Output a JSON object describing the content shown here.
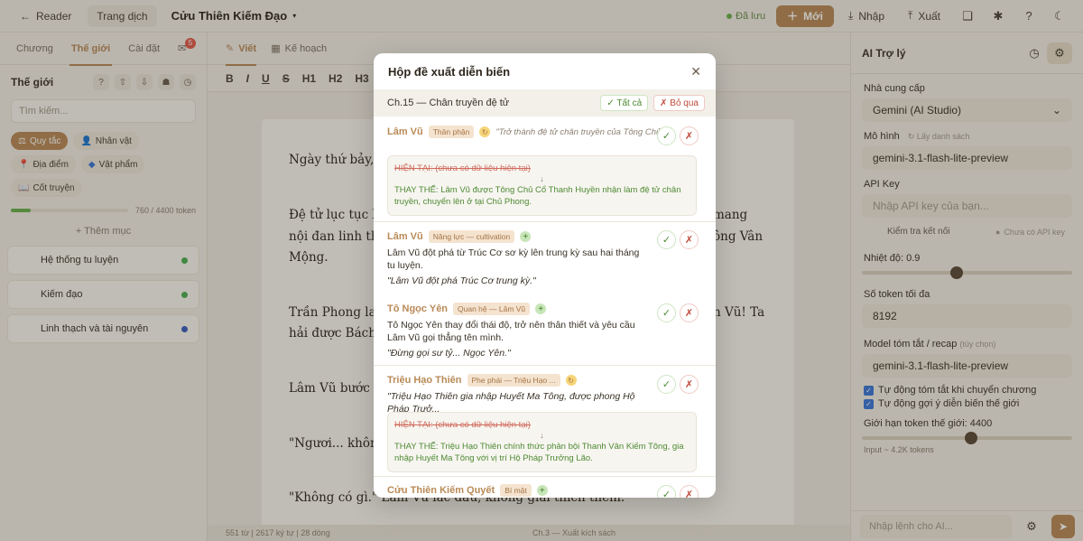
{
  "topbar": {
    "back_label": "Reader",
    "translate_label": "Trang dịch",
    "story_title": "Cửu Thiên Kiếm Đạo",
    "saved_label": "Đã lưu",
    "new_label": "Mới",
    "import_label": "Nhập",
    "export_label": "Xuất"
  },
  "left": {
    "tabs": [
      "Chương",
      "Thế giới",
      "Cài đặt"
    ],
    "notif_count": "5",
    "section_title": "Thế giới",
    "search_placeholder": "Tìm kiếm...",
    "chips": [
      "Quy tắc",
      "Nhân vật",
      "Địa điểm",
      "Vật phẩm",
      "Cốt truyện"
    ],
    "token_usage": "760 / 4400 token",
    "token_fraction": 0.17,
    "add_label": "+ Thêm mục",
    "cards": [
      {
        "label": "Hệ thống tu luyện",
        "color": "#4caf50"
      },
      {
        "label": "Kiếm đạo",
        "color": "#4caf50"
      },
      {
        "label": "Linh thạch và tài nguyên",
        "color": "#3b5fc0"
      }
    ]
  },
  "editor": {
    "tabs": [
      "Viết",
      "Kế hoạch"
    ],
    "format": [
      "B",
      "I",
      "U",
      "S",
      "H1",
      "H2",
      "H3"
    ],
    "paragraphs": [
      "Ngày thứ bảy, c",
      "Đệ tử lục tục bư",
      "nội đan linh th",
      "Mộng.",
      "Trần Phong lao",
      "hải được Bách",
      "Lâm Vũ bước r",
      "\"Ngươi... không",
      "\"Không có gì.\" Lâm Vũ lắc đầu, không giải thích thêm."
    ],
    "right_fragments": [
      "mang",
      "ông Vân",
      "n Vũ! Ta"
    ],
    "footer": "551 từ | 2617 ký tự | 28 dòng",
    "footer_chapter": "Ch.3 — Xuất kích sách"
  },
  "right": {
    "title": "AI Trợ lý",
    "provider_label": "Nhà cung cấp",
    "provider_value": "Gemini (AI Studio)",
    "model_label": "Mô hình",
    "model_refresh": "↻ Lấy danh sách",
    "model_value": "gemini-3.1-flash-lite-preview",
    "apikey_label": "API Key",
    "apikey_placeholder": "Nhập API key của bạn...",
    "check_label": "Kiểm tra kết nối",
    "nokey_label": "Chưa có API key",
    "temp_label": "Nhiệt độ: 0.9",
    "temp_fraction": 0.45,
    "maxtok_label": "Số token tối đa",
    "maxtok_value": "8192",
    "summary_label": "Model tóm tắt / recap",
    "summary_optional": "(tùy chọn)",
    "summary_value": "gemini-3.1-flash-lite-preview",
    "cb1": "Tự động tóm tắt khi chuyển chương",
    "cb2": "Tự động gợi ý diễn biến thế giới",
    "limit_label": "Giới hạn token thế giới: 4400",
    "limit_fraction": 0.52,
    "input_tokens": "Input ~ 4.2K tokens",
    "command_placeholder": "Nhập lệnh cho AI..."
  },
  "modal": {
    "title": "Hộp đề xuất diễn biến",
    "chapter": "Ch.15 — Chân truyền đệ tử",
    "accept_all": "✓ Tất cả",
    "skip": "✗ Bỏ qua",
    "items": [
      {
        "name": "Lâm Vũ",
        "tag": "Thân phận",
        "quote": "\"Trở thành đệ tử chân truyền của Tông Chủ\"",
        "old": "HIỆN TẠI: (chưa có dữ liệu hiện tại)",
        "new": "THAY THẾ: Lâm Vũ được Tông Chủ Cổ Thanh Huyền nhận làm đệ tử chân truyền, chuyển lên ở tại Chủ Phong."
      },
      {
        "name": "Lâm Vũ",
        "tag": "Năng lực — cultivation",
        "desc": "Lâm Vũ đột phá từ Trúc Cơ sơ kỳ lên trung kỳ sau hai tháng tu luyện.",
        "quote": "\"Lâm Vũ đột phá Trúc Cơ trung kỳ.\""
      },
      {
        "name": "Tô Ngọc Yên",
        "tag": "Quan hệ — Lâm Vũ",
        "desc": "Tô Ngọc Yên thay đổi thái độ, trở nên thân thiết và yêu cầu Lâm Vũ gọi thẳng tên mình.",
        "quote": "\"Đừng gọi sư tỷ... Ngọc Yên.\""
      },
      {
        "name": "Triệu Hạo Thiên",
        "tag": "Phe phái — Triệu Hạo ...",
        "quote": "\"Triệu Hạo Thiên gia nhập Huyết Ma Tông, được phong Hộ Pháp Trưở...",
        "old": "HIỆN TẠI: (chưa có dữ liệu hiện tại)",
        "new": "THAY THẾ: Triệu Hạo Thiên chính thức phản bội Thanh Vân Kiếm Tông, gia nhập Huyết Ma Tông với vị trí Hộ Pháp Trưởng Lão."
      },
      {
        "name": "Cửu Thiên Kiếm Quyết",
        "tag": "Bí mật"
      }
    ]
  }
}
